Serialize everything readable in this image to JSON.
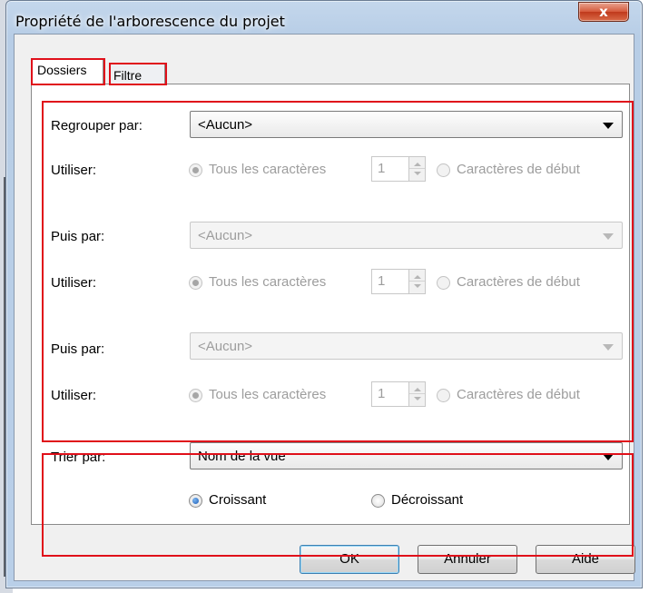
{
  "window": {
    "title": "Propriété de l'arborescence du projet",
    "close_label": "x"
  },
  "tabs": [
    {
      "label": "Dossiers",
      "active": true
    },
    {
      "label": "Filtre",
      "active": false
    }
  ],
  "group": {
    "regrouper_label": "Regrouper par:",
    "regrouper_value": "<Aucun>",
    "puis_label": "Puis par:",
    "puis1_value": "<Aucun>",
    "puis2_value": "<Aucun>",
    "utiliser_label": "Utiliser:",
    "tous_label": "Tous les caractères",
    "debut_label": "Caractères de début",
    "spin_value": "1"
  },
  "sort": {
    "trier_label": "Trier par:",
    "trier_value": "Nom de la vue",
    "croissant_label": "Croissant",
    "decroissant_label": "Décroissant"
  },
  "buttons": {
    "ok": "OK",
    "annuler": "Annuler",
    "aide": "Aide"
  },
  "colors": {
    "highlight": "#e0101a",
    "disabled_text": "#9d9d9d"
  }
}
